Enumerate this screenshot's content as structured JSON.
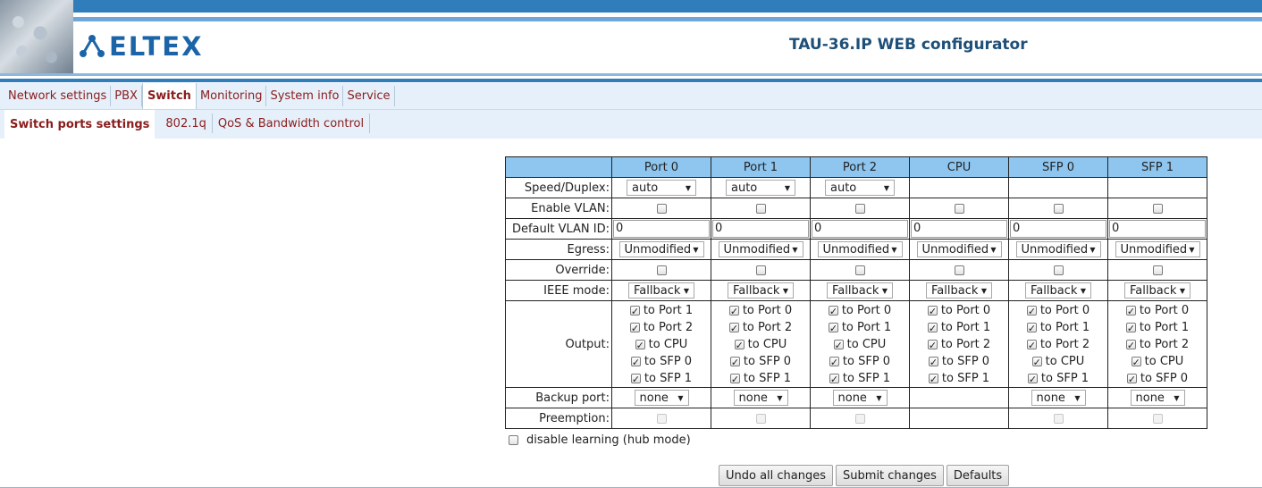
{
  "header": {
    "logo_text": "ELTEX",
    "title": "TAU-36.IP WEB configurator",
    "colors": {
      "brand_blue": "#2f7dbb",
      "tab_text": "#8a1c1c",
      "table_header": "#8ec6f0"
    }
  },
  "nav": {
    "main_tabs": [
      "Network settings",
      "PBX",
      "Switch",
      "Monitoring",
      "System info",
      "Service"
    ],
    "active_main": "Switch",
    "sub_tabs": [
      "Switch ports settings",
      "802.1q",
      "QoS & Bandwidth control"
    ],
    "active_sub": "Switch ports settings"
  },
  "table": {
    "columns": [
      "Port 0",
      "Port 1",
      "Port 2",
      "CPU",
      "SFP 0",
      "SFP 1"
    ],
    "labels": {
      "speed": "Speed/Duplex:",
      "vlan": "Enable VLAN:",
      "vid": "Default VLAN ID:",
      "egress": "Egress:",
      "override": "Override:",
      "ieee": "IEEE mode:",
      "output": "Output:",
      "backup": "Backup port:",
      "preempt": "Preemption:"
    },
    "speed": [
      "auto",
      "auto",
      "auto"
    ],
    "vid": [
      "0",
      "0",
      "0",
      "0",
      "0",
      "0"
    ],
    "egress": [
      "Unmodified",
      "Unmodified",
      "Unmodified",
      "Unmodified",
      "Unmodified",
      "Unmodified"
    ],
    "ieee": [
      "Fallback",
      "Fallback",
      "Fallback",
      "Fallback",
      "Fallback",
      "Fallback"
    ],
    "output": [
      [
        "to Port 1",
        "to Port 2",
        "to CPU",
        "to SFP 0",
        "to SFP 1"
      ],
      [
        "to Port 0",
        "to Port 2",
        "to CPU",
        "to SFP 0",
        "to SFP 1"
      ],
      [
        "to Port 0",
        "to Port 1",
        "to CPU",
        "to SFP 0",
        "to SFP 1"
      ],
      [
        "to Port 0",
        "to Port 1",
        "to Port 2",
        "to SFP 0",
        "to SFP 1"
      ],
      [
        "to Port 0",
        "to Port 1",
        "to Port 2",
        "to CPU",
        "to SFP 1"
      ],
      [
        "to Port 0",
        "to Port 1",
        "to Port 2",
        "to CPU",
        "to SFP 0"
      ]
    ],
    "backup": [
      "none",
      "none",
      "none",
      "",
      "none",
      "none"
    ]
  },
  "options": {
    "disable_learning": "disable learning (hub mode)"
  },
  "buttons": {
    "undo": "Undo all changes",
    "submit": "Submit changes",
    "defaults": "Defaults"
  }
}
